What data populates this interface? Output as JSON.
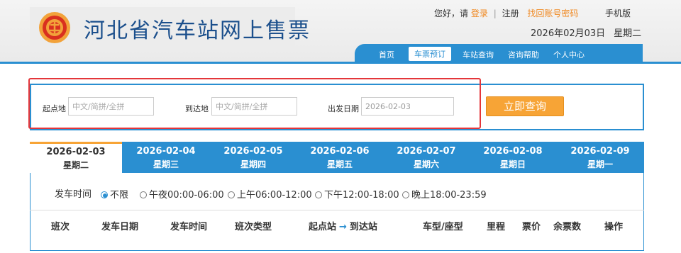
{
  "header": {
    "site_title": "河北省汽车站网上售票",
    "greeting": "您好，请",
    "login": "登录",
    "register": "注册",
    "recover": "找回账号密码",
    "mobile": "手机版",
    "date": "2026年02月03日",
    "weekday": "星期二"
  },
  "nav": {
    "items": [
      {
        "label": "首页"
      },
      {
        "label": "车票预订"
      },
      {
        "label": "车站查询"
      },
      {
        "label": "咨询帮助"
      },
      {
        "label": "个人中心"
      }
    ],
    "active": "车票预订"
  },
  "search": {
    "from_label": "起点地",
    "from_placeholder": "中文/简拼/全拼",
    "to_label": "到达地",
    "to_placeholder": "中文/简拼/全拼",
    "date_label": "出发日期",
    "date_value": "2026-02-03",
    "button": "立即查询"
  },
  "date_tabs": [
    {
      "date": "2026-02-03",
      "weekday": "星期二",
      "active": true
    },
    {
      "date": "2026-02-04",
      "weekday": "星期三"
    },
    {
      "date": "2026-02-05",
      "weekday": "星期四"
    },
    {
      "date": "2026-02-06",
      "weekday": "星期五"
    },
    {
      "date": "2026-02-07",
      "weekday": "星期六"
    },
    {
      "date": "2026-02-08",
      "weekday": "星期日"
    },
    {
      "date": "2026-02-09",
      "weekday": "星期一"
    }
  ],
  "filter": {
    "label": "发车时间",
    "options": [
      {
        "label": "不限",
        "selected": true
      },
      {
        "label": "午夜00:00-06:00"
      },
      {
        "label": "上午06:00-12:00"
      },
      {
        "label": "下午12:00-18:00"
      },
      {
        "label": "晚上18:00-23:59"
      }
    ]
  },
  "table": {
    "columns": [
      "班次",
      "发车日期",
      "发车时间",
      "班次类型",
      "起点站",
      "到达站",
      "车型/座型",
      "里程",
      "票价",
      "余票数",
      "操作"
    ],
    "arrow": "→"
  },
  "colors": {
    "primary": "#2a8fd1",
    "accent": "#f7a436",
    "highlight_box": "#e4363a",
    "title": "#1b4f8c"
  }
}
